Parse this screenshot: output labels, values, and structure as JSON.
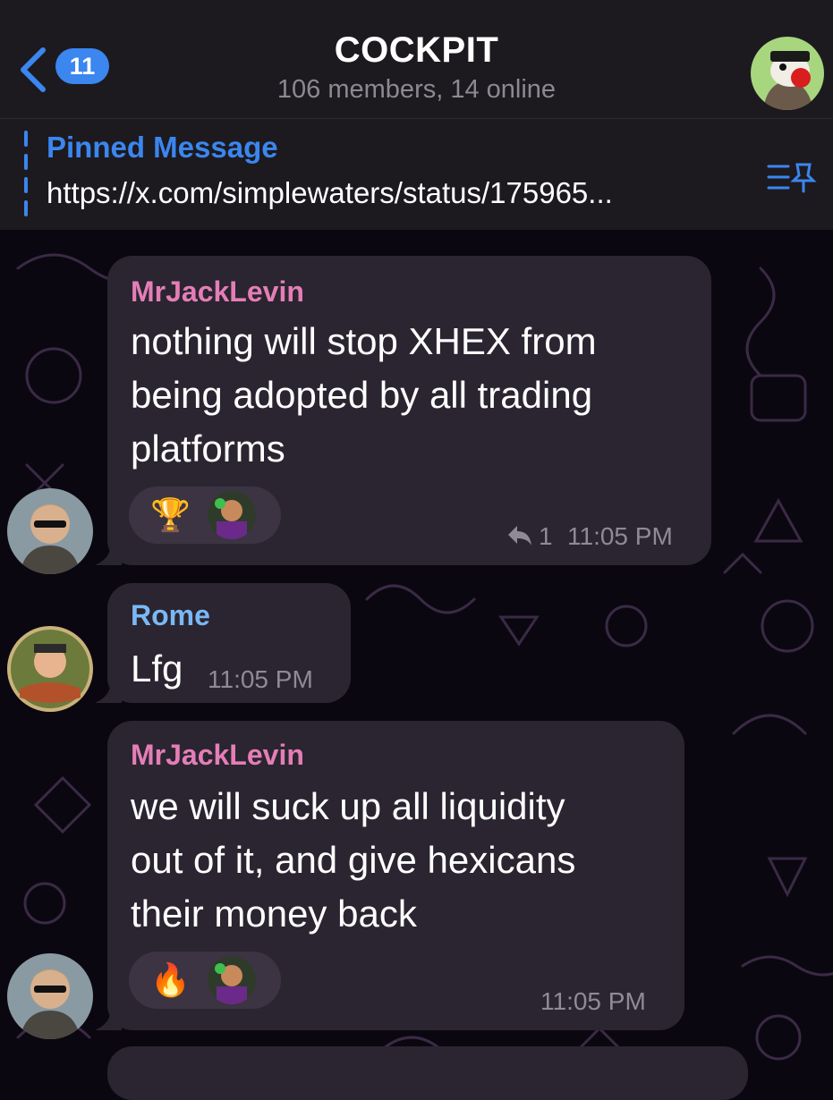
{
  "header": {
    "back_badge": "11",
    "title": "COCKPIT",
    "subtitle": "106 members, 14 online"
  },
  "pinned": {
    "title": "Pinned Message",
    "text": "https://x.com/simplewaters/status/175965..."
  },
  "messages": [
    {
      "sender": "MrJackLevin",
      "sender_color": "#e47eb7",
      "lines": [
        "nothing will stop XHEX from",
        "being adopted by all trading",
        "platforms"
      ],
      "reaction_emoji": "🏆",
      "reply_count": "1",
      "time": "11:05 PM"
    },
    {
      "sender": "Rome",
      "sender_color": "#7ab8f5",
      "lines": [
        "Lfg"
      ],
      "time": "11:05 PM"
    },
    {
      "sender": "MrJackLevin",
      "sender_color": "#e47eb7",
      "lines": [
        "we will suck up all liquidity",
        "out of it, and give hexicans",
        "their money back"
      ],
      "reaction_emoji": "🔥",
      "time": "11:05 PM"
    }
  ],
  "icons": {
    "back": "chevron-left-icon",
    "pinned_list": "pin-list-icon",
    "reply": "reply-arrow-icon"
  },
  "colors": {
    "accent": "#3b86ef",
    "bubble": "#2a2530",
    "header_bg": "#1c1a1f"
  }
}
